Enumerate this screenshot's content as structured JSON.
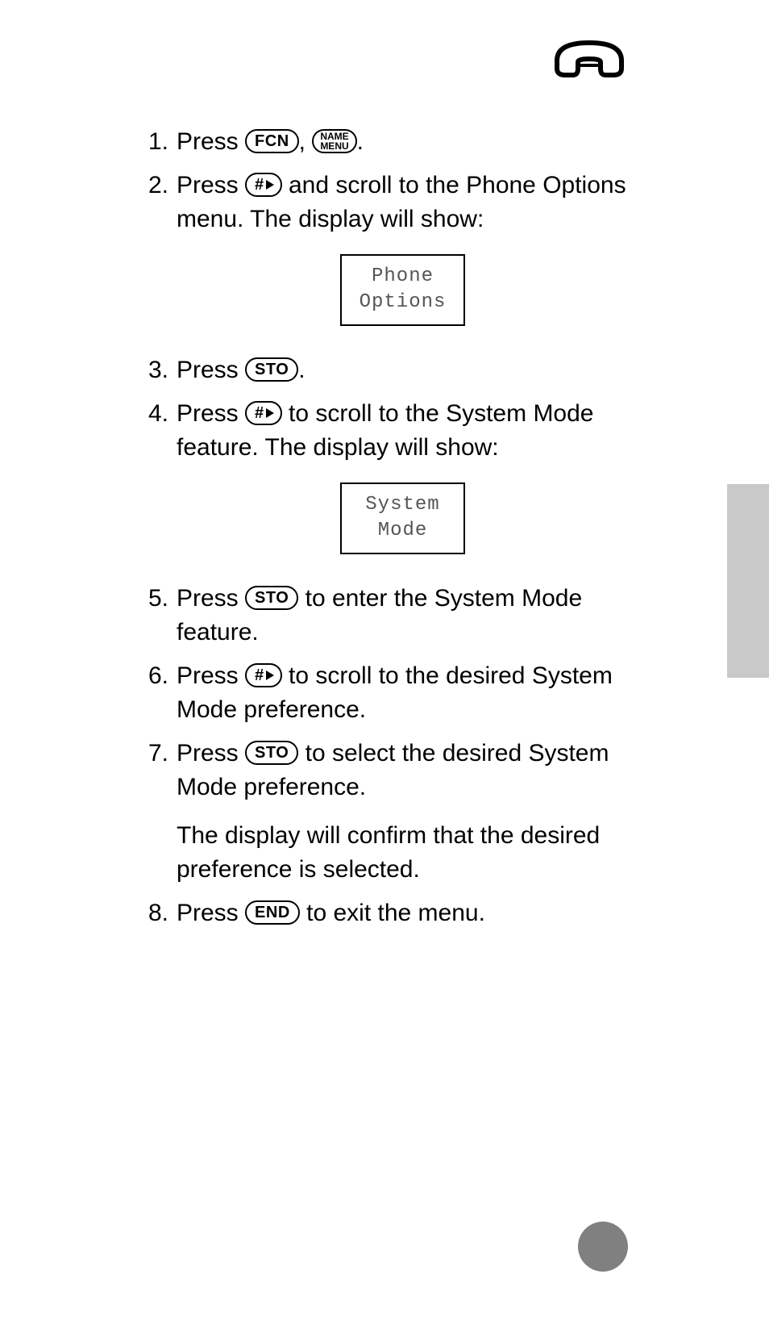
{
  "keys": {
    "fcn": "FCN",
    "name": "NAME",
    "menu": "MENU",
    "hash": "#",
    "sto": "STO",
    "end": "END"
  },
  "displays": {
    "d1_line1": "Phone",
    "d1_line2": "Options",
    "d2_line1": "System",
    "d2_line2": "Mode"
  },
  "steps": {
    "n1": "1.",
    "n2": "2.",
    "n3": "3.",
    "n4": "4.",
    "n5": "5.",
    "n6": "6.",
    "n7": "7.",
    "n8": "8.",
    "s1_a": "Press ",
    "s1_b": ", ",
    "s1_c": ".",
    "s2_a": "Press ",
    "s2_b": " and scroll to the Phone Options menu. The display will show:",
    "s3_a": "Press ",
    "s3_b": ".",
    "s4_a": "Press ",
    "s4_b": " to scroll to the System Mode feature. The display will show:",
    "s5_a": "Press ",
    "s5_b": " to enter the System Mode feature.",
    "s6_a": "Press ",
    "s6_b": " to scroll to the desired System Mode preference.",
    "s7_a": "Press ",
    "s7_b": " to select the desired System Mode preference.",
    "s7_c": "The display will confirm that the desired preference is selected.",
    "s8_a": "Press ",
    "s8_b": " to exit the menu."
  }
}
